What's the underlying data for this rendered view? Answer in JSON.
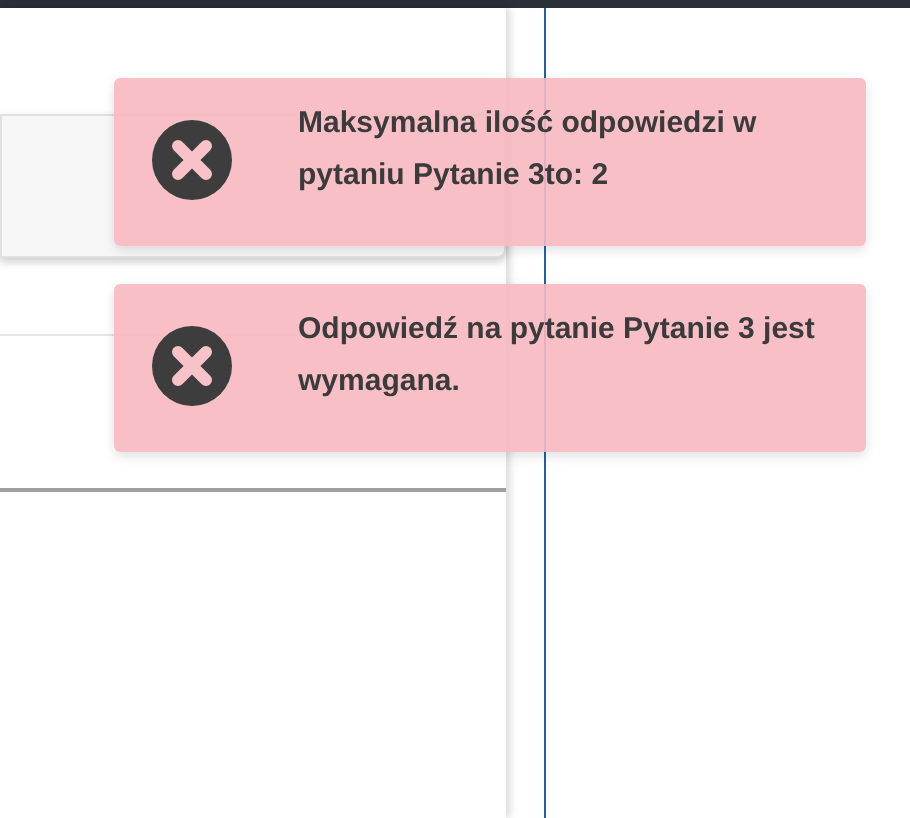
{
  "toasts": [
    {
      "kind": "error",
      "message": "Maksymalna ilość odpowiedzi w pytaniu Pytanie 3to: 2"
    },
    {
      "kind": "error",
      "message": "Odpowiedź na pytanie Pytanie 3 jest wymagana."
    }
  ]
}
